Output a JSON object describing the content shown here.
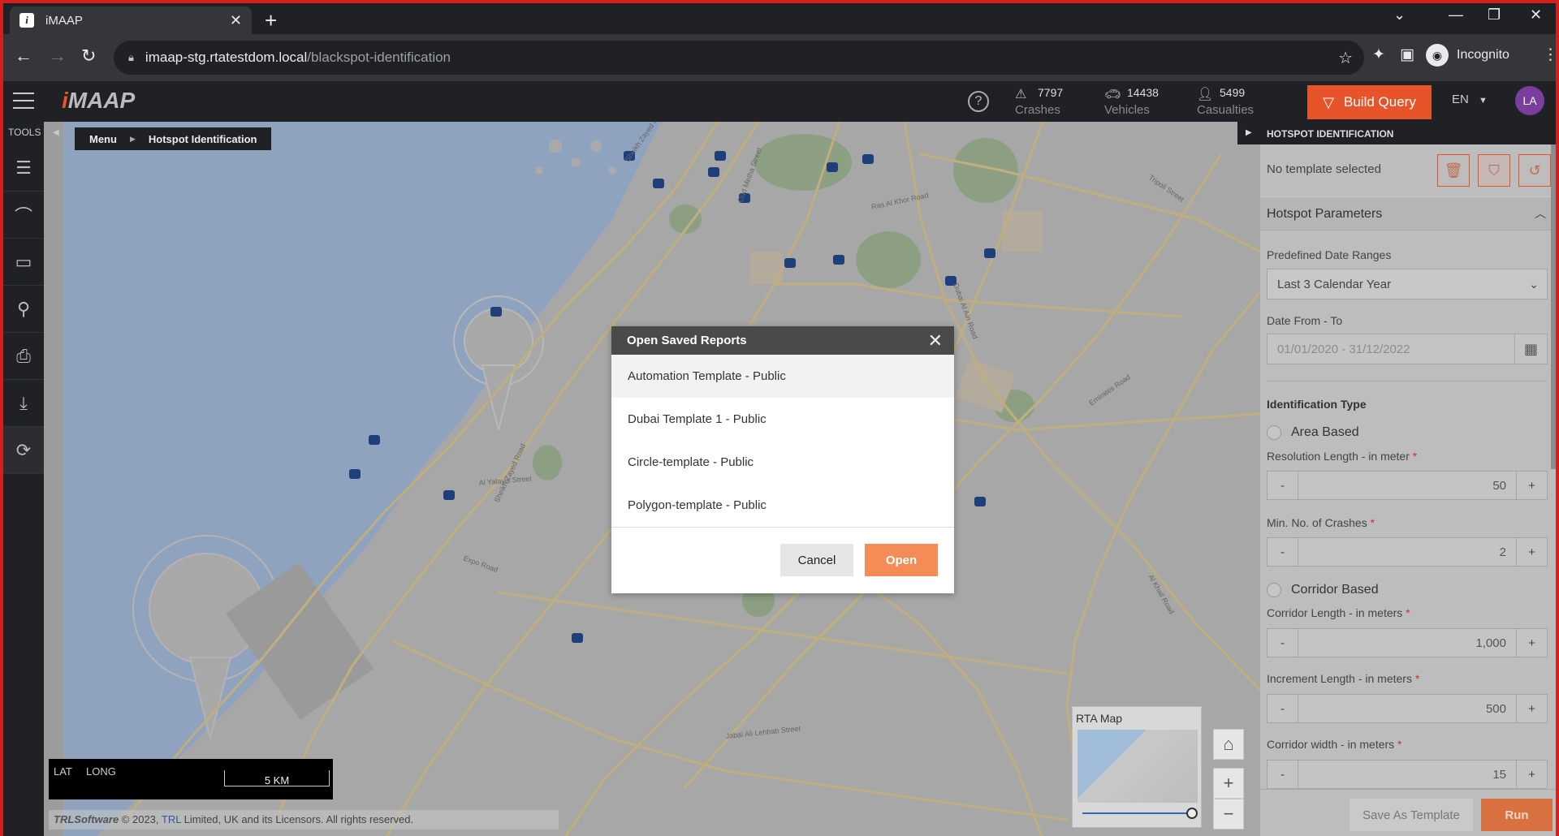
{
  "browser": {
    "tab_title": "iMAAP",
    "tab_favicon": "i",
    "url_host": "imaap-stg.rtatestdom.local",
    "url_path": "/blackspot-identification",
    "profile_label": "Incognito"
  },
  "app": {
    "logo": "iMAAP",
    "stats": [
      {
        "icon": "crash-icon",
        "value": "7797",
        "label": "Crashes"
      },
      {
        "icon": "vehicle-icon",
        "value": "14438",
        "label": "Vehicles"
      },
      {
        "icon": "person-icon",
        "value": "5499",
        "label": "Casualties"
      }
    ],
    "build_query_label": "Build Query",
    "language": "EN",
    "avatar_initials": "LA",
    "accent_color": "#e8542a"
  },
  "tools": {
    "label": "TOOLS",
    "items": [
      "layers-icon",
      "compass-icon",
      "ruler-icon",
      "pin-icon",
      "print-icon",
      "download-icon",
      "refresh-icon"
    ]
  },
  "breadcrumb": {
    "root": "Menu",
    "current": "Hotspot Identification"
  },
  "map": {
    "lat_label": "LAT",
    "long_label": "LONG",
    "scale_label": "5 KM",
    "attribution_brand": "TRLSoftware",
    "attribution_prefix": "© 2023,",
    "attribution_link": "TRL",
    "attribution_suffix": "Limited, UK and its Licensors. All rights reserved.",
    "minimap_title": "RTA Map",
    "road_labels": [
      "Sheikh Zayed Road",
      "Al Khail Road",
      "Emirates Road",
      "Al Yalayis Street",
      "Expo Road",
      "Jabal Ali Lehbab Street",
      "Dubai Al Ain Road",
      "Ras Al Khor Road",
      "Tripoli Street",
      "Oud Metha Street",
      "Sheikh Zayed Road"
    ]
  },
  "right_panel": {
    "header": "HOTSPOT IDENTIFICATION",
    "template_status": "No template selected",
    "section_title": "Hotspot Parameters",
    "predefined_label": "Predefined Date Ranges",
    "predefined_value": "Last 3 Calendar Year",
    "date_label": "Date From - To",
    "date_value": "01/01/2020 - 31/12/2022",
    "identification_type_label": "Identification Type",
    "area_based_label": "Area Based",
    "resolution_label": "Resolution Length - in meter",
    "resolution_value": "50",
    "min_crashes_label": "Min. No. of Crashes",
    "min_crashes_value": "2",
    "corridor_based_label": "Corridor Based",
    "corridor_length_label": "Corridor Length - in meters",
    "corridor_length_value": "1,000",
    "increment_label": "Increment Length - in meters",
    "increment_value": "500",
    "corridor_width_label": "Corridor width - in meters",
    "corridor_width_value": "15",
    "minus": "-",
    "plus": "+",
    "required_mark": "*",
    "save_template_label": "Save As Template",
    "run_label": "Run"
  },
  "modal": {
    "title": "Open Saved Reports",
    "items": [
      "Automation Template - Public",
      "Dubai Template 1 - Public",
      "Circle-template - Public",
      "Polygon-template - Public"
    ],
    "cancel_label": "Cancel",
    "open_label": "Open"
  }
}
